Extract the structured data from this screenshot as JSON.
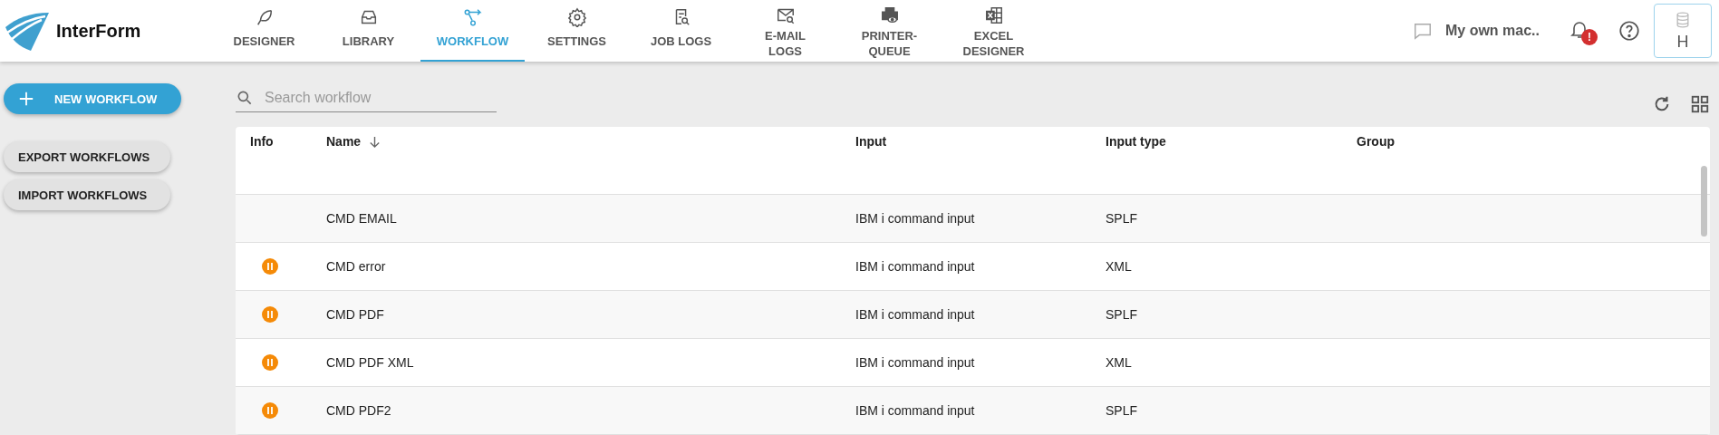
{
  "brand": {
    "name": "InterForm"
  },
  "nav": [
    {
      "label": "DESIGNER",
      "selected": false
    },
    {
      "label": "LIBRARY",
      "selected": false
    },
    {
      "label": "WORKFLOW",
      "selected": true
    },
    {
      "label": "SETTINGS",
      "selected": false
    },
    {
      "label": "JOB LOGS",
      "selected": false
    },
    {
      "label": "E-MAIL LOGS",
      "selected": false
    },
    {
      "label": "PRINTER-QUEUE",
      "selected": false
    },
    {
      "label": "EXCEL DESIGNER",
      "selected": false
    }
  ],
  "user": {
    "name": "My own mac..",
    "notification_badge": "!",
    "server": "H"
  },
  "sidebar": {
    "primary_button": "NEW WORKFLOW",
    "buttons": [
      "EXPORT WORKFLOWS",
      "IMPORT WORKFLOWS"
    ]
  },
  "search": {
    "placeholder": "Search workflow"
  },
  "table": {
    "columns": [
      "Info",
      "Name",
      "Input",
      "Input type",
      "Group"
    ],
    "rows": [
      {
        "paused": false,
        "name": "CMD EMAIL",
        "input": "IBM i command input",
        "input_type": "SPLF"
      },
      {
        "paused": true,
        "name": "CMD error",
        "input": "IBM i command input",
        "input_type": "XML"
      },
      {
        "paused": true,
        "name": "CMD PDF",
        "input": "IBM i command input",
        "input_type": "SPLF"
      },
      {
        "paused": true,
        "name": "CMD PDF XML",
        "input": "IBM i command input",
        "input_type": "XML"
      },
      {
        "paused": true,
        "name": "CMD PDF2",
        "input": "IBM i command input",
        "input_type": "SPLF"
      }
    ]
  }
}
